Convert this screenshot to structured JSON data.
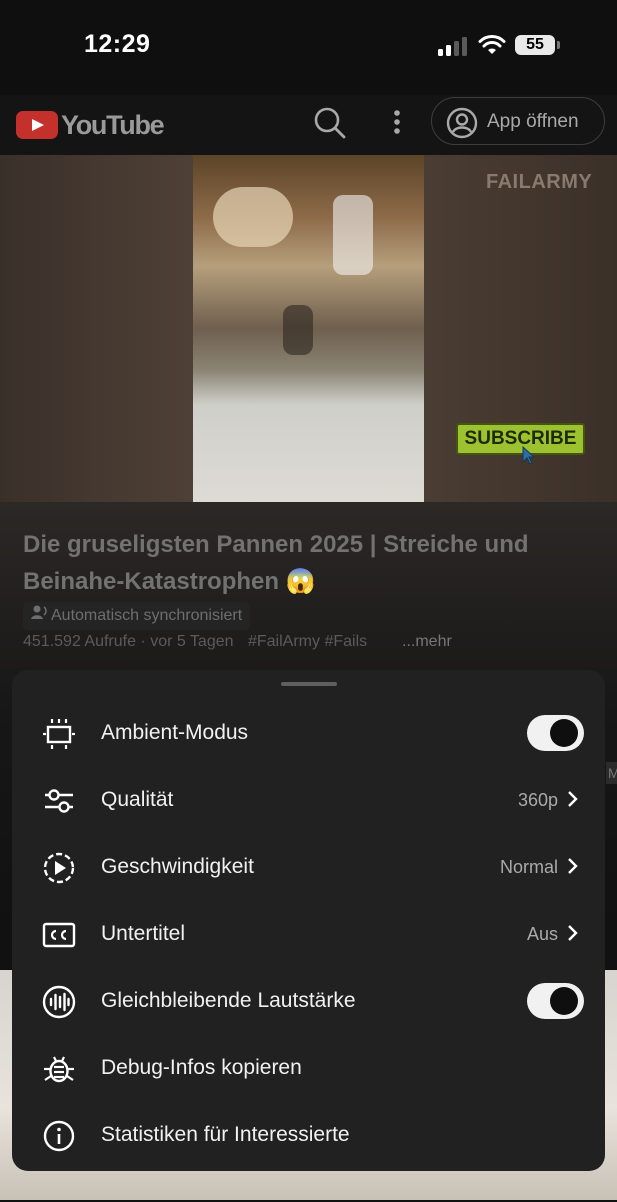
{
  "status_bar": {
    "time": "12:29",
    "battery": "55"
  },
  "header": {
    "logo_text": "YouTube",
    "open_app_label": "App öffnen"
  },
  "video": {
    "watermark": "FAILARMY",
    "subscribe_overlay": "SUBSCRIBE"
  },
  "info": {
    "title": "Die gruseligsten Pannen 2025 | Streiche und Beinahe-Katastrophen 😱",
    "dub_chip": "Automatisch synchronisiert",
    "meta": "451.592 Aufrufe · vor 5 Tagen",
    "tags": "#FailArmy #Fails",
    "more": "...mehr"
  },
  "edge_fragment": "M",
  "menu": {
    "items": [
      {
        "label": "Ambient-Modus",
        "icon": "ambient-icon",
        "toggle": true
      },
      {
        "label": "Qualität",
        "icon": "quality-sliders-icon",
        "value": "360p"
      },
      {
        "label": "Geschwindigkeit",
        "icon": "speed-icon",
        "value": "Normal"
      },
      {
        "label": "Untertitel",
        "icon": "captions-icon",
        "value": "Aus"
      },
      {
        "label": "Gleichbleibende Lautstärke",
        "icon": "volume-icon",
        "toggle": true
      },
      {
        "label": "Debug-Infos kopieren",
        "icon": "bug-icon"
      },
      {
        "label": "Statistiken für Interessierte",
        "icon": "info-icon"
      }
    ]
  },
  "colors": {
    "youtube_red": "#c4302b",
    "sheet_bg": "#212121",
    "subscribe_green": "#9dc22f"
  }
}
